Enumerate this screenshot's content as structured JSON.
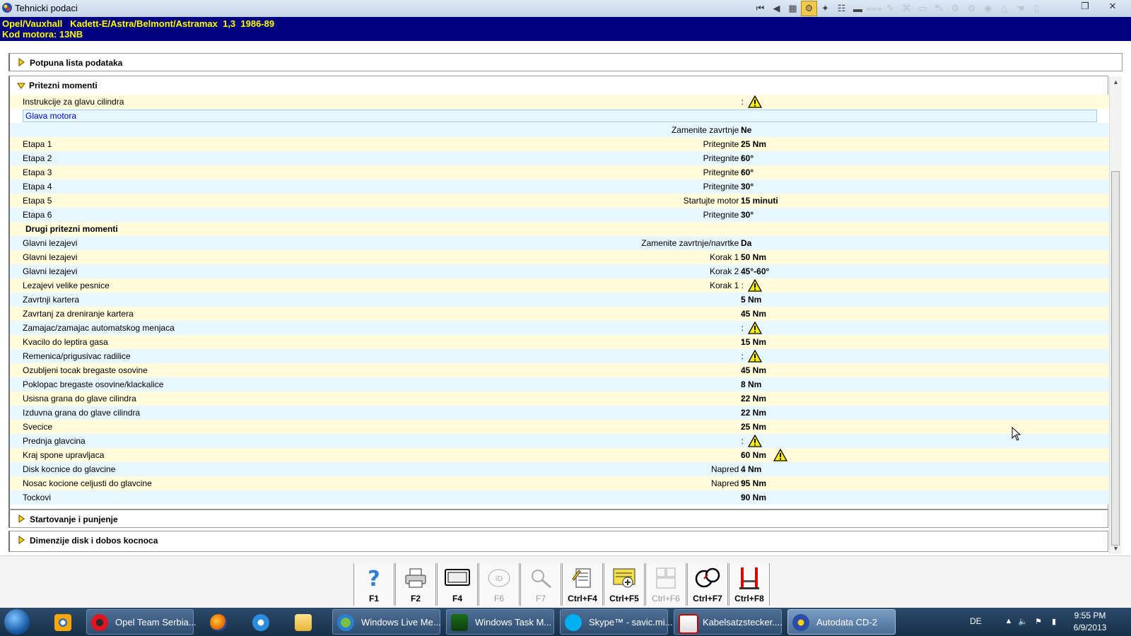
{
  "window": {
    "title": "Tehnicki podaci"
  },
  "header": {
    "vehicle_line": "Opel/Vauxhall   Kadett-E/Astra/Belmont/Astramax  1,3  1986-89",
    "engine_code": "Kod motora: 13NB"
  },
  "sections": {
    "full_list": "Potpuna lista podataka",
    "torque": "Pritezni momenti",
    "starting": "Startovanje i punjenje",
    "brakes": "Dimenzije disk i dobos kocnoca"
  },
  "torque_rows": [
    {
      "c1": "Instrukcije za glavu cilindra",
      "c2": ":",
      "c3": "",
      "warn": true
    },
    {
      "c1": "Glava motora",
      "subheader": true
    },
    {
      "c1": "",
      "c2": "Zamenite zavrtnje :",
      "c3": "Ne"
    },
    {
      "c1": "Etapa 1",
      "c2": "Pritegnite :",
      "c3": "25 Nm"
    },
    {
      "c1": "Etapa 2",
      "c2": "Pritegnite :",
      "c3": "60°"
    },
    {
      "c1": "Etapa 3",
      "c2": "Pritegnite :",
      "c3": "60°"
    },
    {
      "c1": "Etapa 4",
      "c2": "Pritegnite :",
      "c3": "30°"
    },
    {
      "c1": "Etapa 5",
      "c2": "Startujte motor :",
      "c3": "15  minuti"
    },
    {
      "c1": "Etapa 6",
      "c2": "Pritegnite :",
      "c3": "30°"
    },
    {
      "c1": "Drugi pritezni momenti",
      "group": true
    },
    {
      "c1": "Glavni lezajevi",
      "c2": "Zamenite zavrtnje/navrtke :",
      "c3": "Da"
    },
    {
      "c1": "Glavni lezajevi",
      "c2": "Korak 1 :",
      "c3": "50 Nm"
    },
    {
      "c1": "Glavni lezajevi",
      "c2": "Korak 2 :",
      "c3": "45°-60°"
    },
    {
      "c1": "Lezajevi velike pesnice",
      "c2": "Korak 1 :",
      "c3": "",
      "warn": true
    },
    {
      "c1": "Zavrtnji kartera",
      "c2": ":",
      "c3": "5 Nm"
    },
    {
      "c1": "Zavrtanj za dreniranje kartera",
      "c2": ":",
      "c3": "45 Nm"
    },
    {
      "c1": "Zamajac/zamajac automatskog menjaca",
      "c2": ":",
      "c3": "",
      "warn": true
    },
    {
      "c1": "Kvacilo do leptira gasa",
      "c2": ":",
      "c3": "15 Nm"
    },
    {
      "c1": "Remenica/prigusivac radilice",
      "c2": ":",
      "c3": "",
      "warn": true
    },
    {
      "c1": "Ozubljeni tocak bregaste osovine",
      "c2": ":",
      "c3": "45 Nm"
    },
    {
      "c1": "Poklopac bregaste osovine/klackalice",
      "c2": ":",
      "c3": "8 Nm"
    },
    {
      "c1": "Usisna grana do glave cilindra",
      "c2": ":",
      "c3": "22 Nm"
    },
    {
      "c1": "Izduvna grana do glave cilindra",
      "c2": ":",
      "c3": "22 Nm"
    },
    {
      "c1": "Svecice",
      "c2": ":",
      "c3": "25 Nm"
    },
    {
      "c1": "Prednja glavcina",
      "c2": ":",
      "c3": "",
      "warn": true
    },
    {
      "c1": "Kraj spone upravljaca",
      "c2": ":",
      "c3": "60 Nm",
      "warn_after": true
    },
    {
      "c1": "Disk kocnice do glavcine",
      "c2": "Napred :",
      "c3": "4 Nm"
    },
    {
      "c1": "Nosac kocione celjusti do glavcine",
      "c2": "Napred :",
      "c3": "95 Nm"
    },
    {
      "c1": "Tockovi",
      "c2": ":",
      "c3": "90 Nm"
    }
  ],
  "function_keys": [
    {
      "label": "F1",
      "icon": "help-icon",
      "enabled": true
    },
    {
      "label": "F2",
      "icon": "printer-icon",
      "enabled": true
    },
    {
      "label": "F4",
      "icon": "screen-icon",
      "enabled": true
    },
    {
      "label": "F6",
      "icon": "id-icon",
      "enabled": false
    },
    {
      "label": "F7",
      "icon": "zoom-icon",
      "enabled": false
    },
    {
      "label": "Ctrl+F4",
      "icon": "notes-icon",
      "enabled": true
    },
    {
      "label": "Ctrl+F5",
      "icon": "add-note-icon",
      "enabled": true
    },
    {
      "label": "Ctrl+F6",
      "icon": "sequence-icon",
      "enabled": false
    },
    {
      "label": "Ctrl+F7",
      "icon": "gauges-icon",
      "enabled": true
    },
    {
      "label": "Ctrl+F8",
      "icon": "lift-icon",
      "enabled": true
    }
  ],
  "taskbar": {
    "items": [
      {
        "label": "",
        "icon": "eye-app-icon",
        "pinned": true
      },
      {
        "label": "Opel Team Serbia...",
        "icon": "opera-icon"
      },
      {
        "label": "",
        "icon": "firefox-icon",
        "pinned": true
      },
      {
        "label": "",
        "icon": "ie-icon",
        "pinned": true
      },
      {
        "label": "",
        "icon": "folder-icon",
        "pinned": true
      },
      {
        "label": "Windows Live Me...",
        "icon": "messenger-icon"
      },
      {
        "label": "Windows Task M...",
        "icon": "task-manager-icon"
      },
      {
        "label": "Skype™ - savic.mi...",
        "icon": "skype-icon"
      },
      {
        "label": "Kabelsatzstecker....",
        "icon": "pdf-icon"
      },
      {
        "label": "Autodata CD-2",
        "icon": "autodata-icon",
        "active": true
      }
    ],
    "lang": "DE",
    "time": "9:55 PM",
    "date": "6/9/2013"
  },
  "colors": {
    "header_bg": "#000080",
    "header_text": "#ffff00",
    "row_yellow": "#fffbdc",
    "row_blue": "#e7f7fe",
    "subheader_text": "#0000c0"
  }
}
